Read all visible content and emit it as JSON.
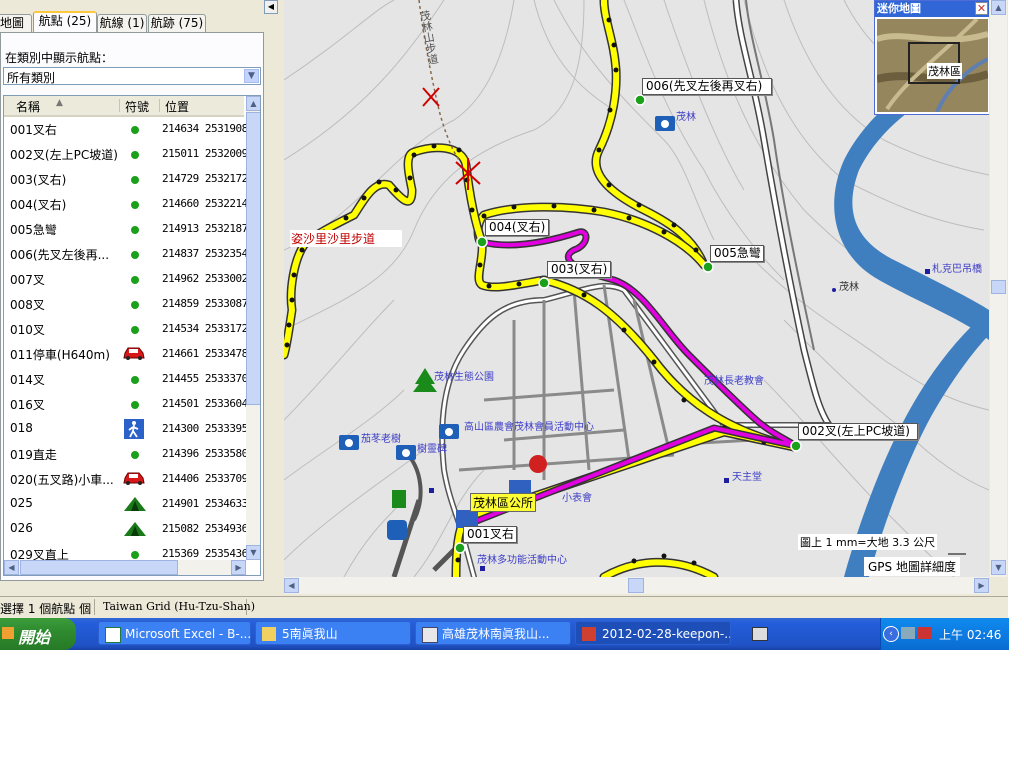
{
  "tabs": [
    {
      "label": "地圖"
    },
    {
      "label": "航點 (25)"
    },
    {
      "label": "航線 (1)"
    },
    {
      "label": "航跡 (75)"
    }
  ],
  "category": {
    "label": "在類別中顯示航點：",
    "value": "所有類別"
  },
  "columns": {
    "name": "名稱",
    "symbol": "符號",
    "position": "位置"
  },
  "waypoints": [
    {
      "name": "001叉右",
      "symbol": "dot",
      "coord": "214634 2531908"
    },
    {
      "name": "002叉(左上PC坡道)",
      "symbol": "dot",
      "coord": "215011 2532009"
    },
    {
      "name": "003(叉右)",
      "symbol": "dot",
      "coord": "214729 2532172"
    },
    {
      "name": "004(叉右)",
      "symbol": "dot",
      "coord": "214660 2532214"
    },
    {
      "name": "005急彎",
      "symbol": "dot",
      "coord": "214913 2532187"
    },
    {
      "name": "006(先叉左後再...",
      "symbol": "dot",
      "coord": "214837 2532354"
    },
    {
      "name": "007叉",
      "symbol": "dot",
      "coord": "214962 2533002"
    },
    {
      "name": "008叉",
      "symbol": "dot",
      "coord": "214859 2533087"
    },
    {
      "name": "010叉",
      "symbol": "dot",
      "coord": "214534 2533172"
    },
    {
      "name": "011停車(H640m)",
      "symbol": "car",
      "coord": "214661 2533478"
    },
    {
      "name": "014叉",
      "symbol": "dot",
      "coord": "214455 2533370"
    },
    {
      "name": "016叉",
      "symbol": "dot",
      "coord": "214501 2533604"
    },
    {
      "name": "018",
      "symbol": "hiker",
      "coord": "214300 2533395"
    },
    {
      "name": "019直走",
      "symbol": "dot",
      "coord": "214396 2533580"
    },
    {
      "name": "020(五叉路)小車...",
      "symbol": "car",
      "coord": "214406 2533709"
    },
    {
      "name": "025",
      "symbol": "tent",
      "coord": "214901 2534633"
    },
    {
      "name": "026",
      "symbol": "tent",
      "coord": "215082 2534936"
    },
    {
      "name": "029叉直上",
      "symbol": "dot",
      "coord": "215369 2535436"
    }
  ],
  "map": {
    "wp_labels": {
      "w006": "006(先叉左後再叉右)",
      "w004": "004(叉右)",
      "w005": "005急彎",
      "w003": "003(叉右)",
      "w002": "002叉(左上PC坡道)",
      "w001": "001叉右"
    },
    "trail_label": "姿沙里沙里步道",
    "vertical_trail_label": "茂林山步道",
    "poi": {
      "maolin_top": "茂林",
      "maolin_right": "茂林",
      "jakebalu": "札克巴吊橋（",
      "ecopark": "茂林生態公園",
      "church": "茂林長老教會",
      "farmers": "高山區農會茂林會員活動中心",
      "tree": "茄苳老樹",
      "temple": "天主堂",
      "office": "茂林區公所",
      "activity": "茂林多功能活動中心",
      "xuehui": "小表會",
      "shenmu": "樹靈碑"
    },
    "scale": "圖上 1 mm=大地 3.3 公尺",
    "detail": "GPS 地圖詳細度",
    "minimap_title": "迷你地圖",
    "minimap_town": "茂林區",
    "colors": {
      "route": "#e000e0",
      "track": "#ffff00",
      "river": "#3f7fc0"
    }
  },
  "status": {
    "left": "選擇 1 個航點 個",
    "grid": "Taiwan Grid (Hu-Tzu-Shan)"
  },
  "taskbar": {
    "start": "開始",
    "tasks": [
      {
        "label": "Microsoft Excel - B-..."
      },
      {
        "label": "5南眞我山"
      },
      {
        "label": "高雄茂林南眞我山..."
      },
      {
        "label": "2012-02-28-keepon-..."
      }
    ],
    "clock": "上午 02:46"
  }
}
